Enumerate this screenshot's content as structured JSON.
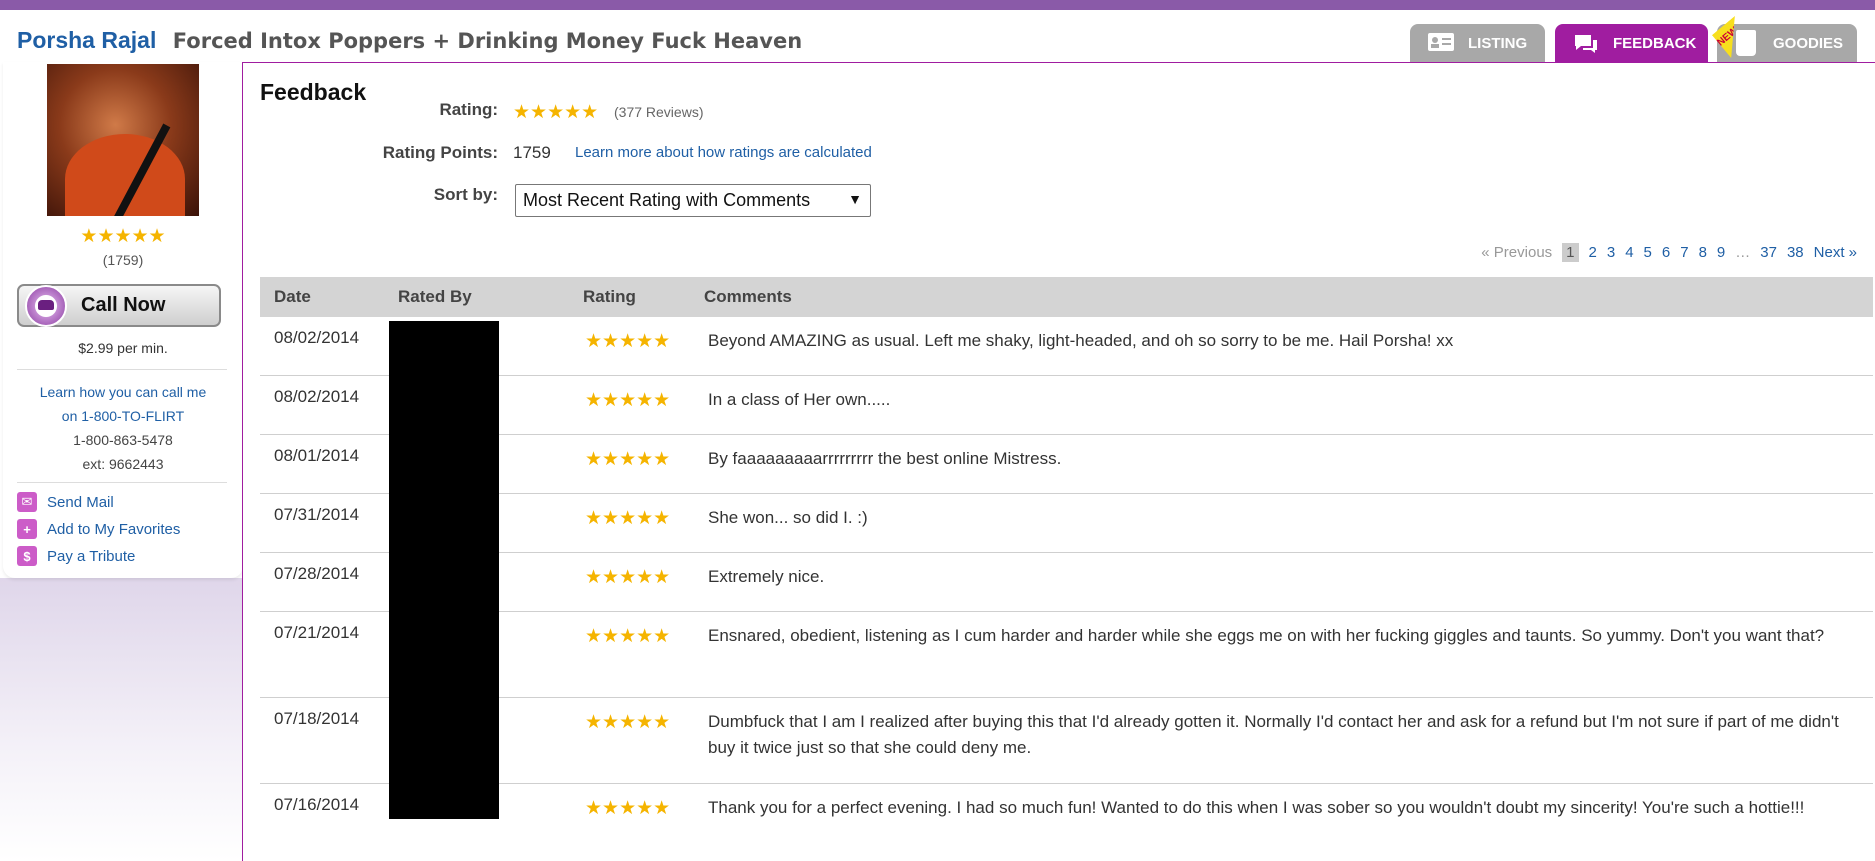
{
  "header": {
    "performer_name": "Porsha Rajal",
    "listing_title": "Forced Intox Poppers + Drinking Money Fuck Heaven"
  },
  "tabs": [
    {
      "label": "LISTING",
      "icon": "id-card-icon"
    },
    {
      "label": "FEEDBACK",
      "icon": "chat-bubbles-icon",
      "active": true
    },
    {
      "label": "GOODIES",
      "icon": "shopping-bag-icon",
      "badge": "NEW"
    }
  ],
  "sidebar": {
    "stars": "★★★★★",
    "rating_points": "(1759)",
    "call_button": "Call Now",
    "price": "$2.99 per min.",
    "learn_text_1": "Learn how you can call me",
    "learn_text_2": "on 1-800-TO-FLIRT",
    "phone": "1-800-863-5478",
    "extension": "ext: 9662443",
    "links": [
      "Send Mail",
      "Add to My Favorites",
      "Pay a Tribute"
    ]
  },
  "feedback": {
    "heading": "Feedback",
    "rating_label": "Rating:",
    "rating_stars": "★★★★★",
    "review_count": "(377 Reviews)",
    "points_label": "Rating Points:",
    "points_value": "1759",
    "points_link": "Learn more about how ratings are calculated",
    "sort_label": "Sort by:",
    "sort_value": "Most Recent Rating with Comments",
    "sort_arrow": "▼"
  },
  "pagination": {
    "prev": "« Previous",
    "current": "1",
    "pages": [
      "2",
      "3",
      "4",
      "5",
      "6",
      "7",
      "8",
      "9"
    ],
    "ellipsis": "…",
    "tail": [
      "37",
      "38"
    ],
    "next": "Next »"
  },
  "table": {
    "columns": [
      "Date",
      "Rated By",
      "Rating",
      "Comments"
    ],
    "rows": [
      {
        "date": "08/02/2014",
        "stars": "★★★★★",
        "comment": "Beyond AMAZING as usual. Left me shaky, light-headed, and oh so sorry to be me. Hail Porsha! xx"
      },
      {
        "date": "08/02/2014",
        "stars": "★★★★★",
        "comment": "In a class of Her own....."
      },
      {
        "date": "08/01/2014",
        "stars": "★★★★★",
        "comment": "By faaaaaaaaarrrrrrrrr the best online Mistress."
      },
      {
        "date": "07/31/2014",
        "stars": "★★★★★",
        "comment": "She won... so did I. :)"
      },
      {
        "date": "07/28/2014",
        "stars": "★★★★★",
        "comment": "Extremely nice."
      },
      {
        "date": "07/21/2014",
        "stars": "★★★★★",
        "comment": "Ensnared, obedient, listening as I cum harder and harder while she eggs me on with her fucking giggles and taunts. So yummy. Don't you want that?"
      },
      {
        "date": "07/18/2014",
        "stars": "★★★★★",
        "comment": "Dumbfuck that I am I realized after buying this that I'd already gotten it. Normally I'd contact her and ask for a refund but I'm not sure if part of me didn't buy it twice just so that she could deny me."
      },
      {
        "date": "07/16/2014",
        "stars": "★★★★★",
        "comment": "Thank you for a perfect evening. I had so much fun! Wanted to do this when I was sober so you wouldn't doubt my sincerity! You're such a hottie!!!"
      }
    ]
  },
  "colors": {
    "brand_purple": "#8a5aa8",
    "active_tab": "#a01da0",
    "link_blue": "#1f5fa5",
    "star_gold": "#f5b400"
  }
}
